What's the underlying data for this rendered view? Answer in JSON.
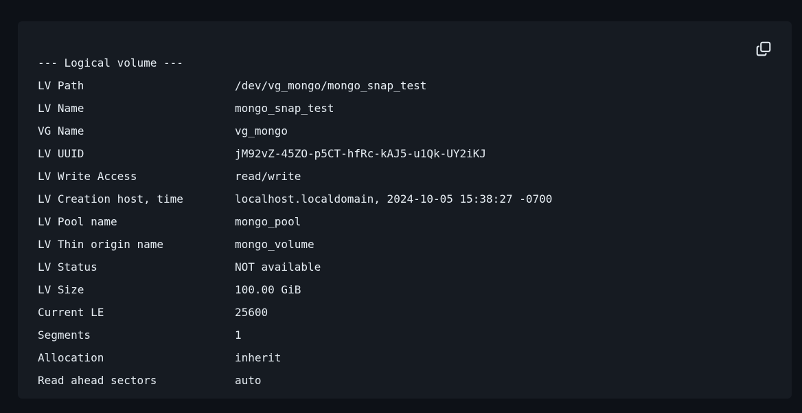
{
  "code_block": {
    "header": "--- Logical volume ---",
    "rows": [
      {
        "label": "LV Path",
        "value": "/dev/vg_mongo/mongo_snap_test"
      },
      {
        "label": "LV Name",
        "value": "mongo_snap_test"
      },
      {
        "label": "VG Name",
        "value": "vg_mongo"
      },
      {
        "label": "LV UUID",
        "value": "jM92vZ-45ZO-p5CT-hfRc-kAJ5-u1Qk-UY2iKJ"
      },
      {
        "label": "LV Write Access",
        "value": "read/write"
      },
      {
        "label": "LV Creation host, time",
        "value": "localhost.localdomain, 2024-10-05 15:38:27 -0700"
      },
      {
        "label": "LV Pool name",
        "value": "mongo_pool"
      },
      {
        "label": "LV Thin origin name",
        "value": "mongo_volume"
      },
      {
        "label": "LV Status",
        "value": "NOT available"
      },
      {
        "label": "LV Size",
        "value": "100.00 GiB"
      },
      {
        "label": "Current LE",
        "value": "25600"
      },
      {
        "label": "Segments",
        "value": "1"
      },
      {
        "label": "Allocation",
        "value": "inherit"
      },
      {
        "label": "Read ahead sectors",
        "value": "auto"
      }
    ]
  },
  "copy_icon": "copy-icon",
  "colors": {
    "background": "#0d1117",
    "code_background": "#161b22",
    "text": "#e6edf3"
  }
}
